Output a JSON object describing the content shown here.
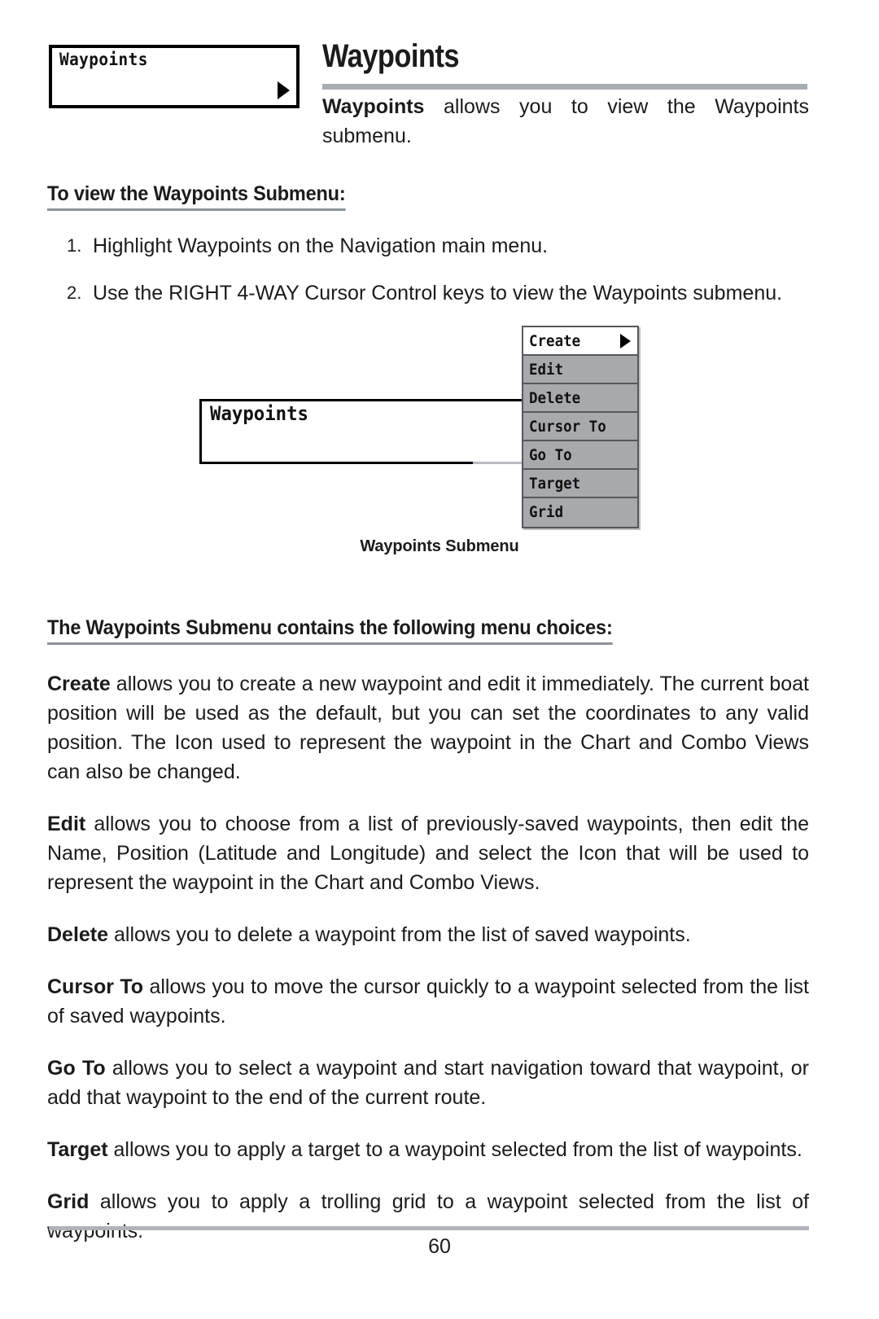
{
  "document": {
    "page_number": "60"
  },
  "header": {
    "lcd_menu_label": "Waypoints",
    "lcd_arrow_icon": "right-triangle-icon",
    "title": "Waypoints",
    "intro_bold": "Waypoints",
    "intro_rest": " allows you to view the Waypoints submenu."
  },
  "procedure": {
    "heading": "To view the Waypoints Submenu:",
    "steps": [
      {
        "num": "1.",
        "text": "Highlight Waypoints on the Navigation main menu."
      },
      {
        "num": "2.",
        "text": "Use the RIGHT 4-WAY Cursor Control keys to view the Waypoints submenu."
      }
    ]
  },
  "diagram": {
    "box_label": "Waypoints",
    "caption": "Waypoints Submenu",
    "submenu_items": [
      {
        "label": "Create",
        "selected": true,
        "arrow": "right-triangle-icon"
      },
      {
        "label": "Edit",
        "selected": false,
        "arrow": ""
      },
      {
        "label": "Delete",
        "selected": false,
        "arrow": ""
      },
      {
        "label": "Cursor To",
        "selected": false,
        "arrow": ""
      },
      {
        "label": "Go To",
        "selected": false,
        "arrow": ""
      },
      {
        "label": "Target",
        "selected": false,
        "arrow": ""
      },
      {
        "label": "Grid",
        "selected": false,
        "arrow": ""
      }
    ]
  },
  "choices": {
    "heading": "The Waypoints Submenu contains the following menu choices:",
    "entries": [
      {
        "term": "Create",
        "text": " allows you to create a new waypoint and edit it immediately.  The current boat position will be used as the default, but you can set the coordinates to any valid position. The Icon used to represent the waypoint in the Chart and Combo Views can also be changed."
      },
      {
        "term": "Edit",
        "text": " allows you to choose from a list of previously-saved waypoints, then edit the Name, Position (Latitude and Longitude) and select the Icon that will be used to represent the waypoint in the Chart and Combo Views."
      },
      {
        "term": "Delete",
        "text": " allows you to delete a waypoint from the list of saved waypoints."
      },
      {
        "term": "Cursor To",
        "text": " allows you to move the cursor quickly to a waypoint selected from the list of saved waypoints."
      },
      {
        "term": "Go To",
        "text": " allows you to select a waypoint and start navigation toward that waypoint, or add that waypoint to the end of the current route."
      },
      {
        "term": "Target",
        "text": " allows you to apply a target to a waypoint selected from the list of waypoints."
      },
      {
        "term": "Grid",
        "text": " allows you to apply a trolling grid to a waypoint selected from the list of waypoints."
      }
    ]
  }
}
